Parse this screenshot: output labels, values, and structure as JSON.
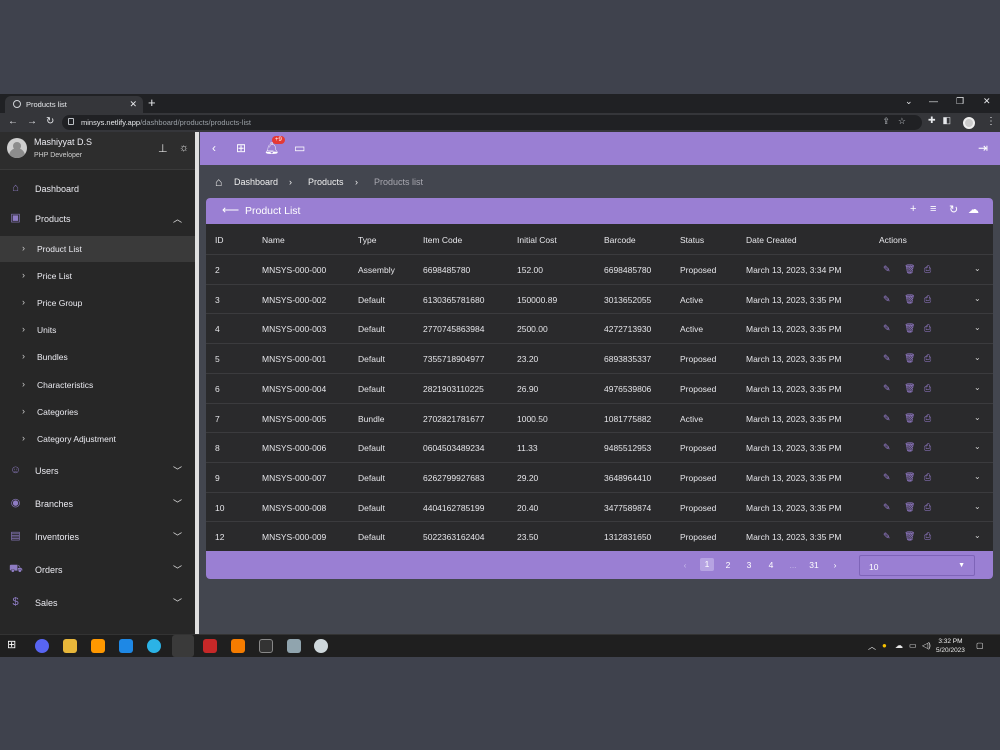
{
  "browser": {
    "tab_title": "Products list",
    "url_host": "minsys.netlify.app",
    "url_path": "/dashboard/products/products-list"
  },
  "user": {
    "name": "Mashiyyat D.S",
    "role": "PHP Developer"
  },
  "topbar": {
    "notification_badge": "+9"
  },
  "sidebar": {
    "items": [
      {
        "label": "Dashboard",
        "icon": "home-icon"
      },
      {
        "label": "Products",
        "icon": "bag-icon",
        "expanded": true
      },
      {
        "label": "Users",
        "icon": "user-icon"
      },
      {
        "label": "Branches",
        "icon": "location-icon"
      },
      {
        "label": "Inventories",
        "icon": "archive-icon"
      },
      {
        "label": "Orders",
        "icon": "cart-icon"
      },
      {
        "label": "Sales",
        "icon": "dollar-icon"
      }
    ],
    "product_subitems": [
      "Product List",
      "Price List",
      "Price Group",
      "Units",
      "Bundles",
      "Characteristics",
      "Categories",
      "Category Adjustment"
    ]
  },
  "breadcrumb": {
    "home": "Dashboard",
    "parent": "Products",
    "current": "Products list"
  },
  "panel": {
    "title": "Product List"
  },
  "table": {
    "columns": [
      "ID",
      "Name",
      "Type",
      "Item Code",
      "Initial Cost",
      "Barcode",
      "Status",
      "Date Created",
      "Actions"
    ],
    "rows": [
      [
        "2",
        "MNSYS-000-000",
        "Assembly",
        "6698485780",
        "152.00",
        "6698485780",
        "Proposed",
        "March 13, 2023, 3:34 PM"
      ],
      [
        "3",
        "MNSYS-000-002",
        "Default",
        "6130365781680",
        "150000.89",
        "3013652055",
        "Active",
        "March 13, 2023, 3:35 PM"
      ],
      [
        "4",
        "MNSYS-000-003",
        "Default",
        "2770745863984",
        "2500.00",
        "4272713930",
        "Active",
        "March 13, 2023, 3:35 PM"
      ],
      [
        "5",
        "MNSYS-000-001",
        "Default",
        "7355718904977",
        "23.20",
        "6893835337",
        "Proposed",
        "March 13, 2023, 3:35 PM"
      ],
      [
        "6",
        "MNSYS-000-004",
        "Default",
        "2821903110225",
        "26.90",
        "4976539806",
        "Proposed",
        "March 13, 2023, 3:35 PM"
      ],
      [
        "7",
        "MNSYS-000-005",
        "Bundle",
        "2702821781677",
        "1000.50",
        "1081775882",
        "Active",
        "March 13, 2023, 3:35 PM"
      ],
      [
        "8",
        "MNSYS-000-006",
        "Default",
        "0604503489234",
        "11.33",
        "9485512953",
        "Proposed",
        "March 13, 2023, 3:35 PM"
      ],
      [
        "9",
        "MNSYS-000-007",
        "Default",
        "6262799927683",
        "29.20",
        "3648964410",
        "Proposed",
        "March 13, 2023, 3:35 PM"
      ],
      [
        "10",
        "MNSYS-000-008",
        "Default",
        "4404162785199",
        "20.40",
        "3477589874",
        "Proposed",
        "March 13, 2023, 3:35 PM"
      ],
      [
        "12",
        "MNSYS-000-009",
        "Default",
        "5022363162404",
        "23.50",
        "1312831650",
        "Proposed",
        "March 13, 2023, 3:35 PM"
      ]
    ]
  },
  "pagination": {
    "pages": [
      "1",
      "2",
      "3",
      "4",
      "...",
      "31"
    ],
    "current": "1",
    "per_page": "10"
  },
  "taskbar": {
    "time": "3:32 PM",
    "date": "5/20/2023"
  },
  "colors": {
    "accent": "#9a7fd3",
    "background": "#43464f",
    "sidebar": "#272727"
  }
}
